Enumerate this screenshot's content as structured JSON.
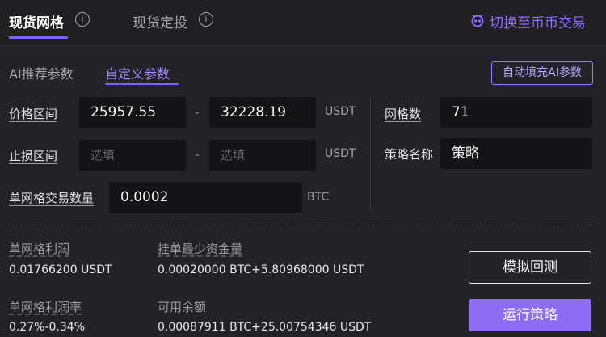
{
  "tabs": {
    "grid": "现货网格",
    "fixed": "现货定投",
    "info": "i"
  },
  "switch_label": "切换至币币交易",
  "subtabs": {
    "ai": "AI推荐参数",
    "custom": "自定义参数"
  },
  "autofill_label": "自动填充AI参数",
  "price_range": {
    "label": "价格区间",
    "low": "25957.55",
    "sep": "-",
    "high": "32228.19",
    "unit": "USDT"
  },
  "stop_range": {
    "label": "止损区间",
    "low_placeholder": "选填",
    "sep": "-",
    "high_placeholder": "选填",
    "unit": "USDT"
  },
  "grid_count": {
    "label": "网格数",
    "value": "71"
  },
  "strategy_name": {
    "label": "策略名称",
    "value": "策略"
  },
  "per_grid_qty": {
    "label": "单网格交易数量",
    "value": "0.0002",
    "unit": "BTC"
  },
  "stats": {
    "profit_label": "单网格利润",
    "profit_value": "0.01766200 USDT",
    "min_fund_label": "挂单最少资金量",
    "min_fund_value": "0.00020000 BTC+5.80968000 USDT",
    "profit_rate_label": "单网格利润率",
    "profit_rate_value": "0.27%-0.34%",
    "available_label": "可用余额",
    "available_value": "0.00087911 BTC+25.00754346 USDT"
  },
  "buttons": {
    "backtest": "模拟回测",
    "run": "运行策略"
  },
  "colors": {
    "accent": "#8b6cf2",
    "background": "#232327",
    "input_bg": "#141416"
  },
  "icons": {
    "info": "info-icon",
    "switch": "switch-icon"
  }
}
